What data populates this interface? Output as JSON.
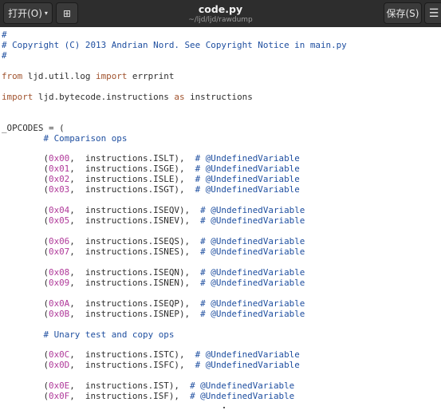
{
  "toolbar": {
    "open_label": "打开(O)",
    "open_chevron": "▾",
    "new_tab_icon_glyph": "⊞",
    "save_label": "保存(S)",
    "menu_glyph": "☰"
  },
  "window": {
    "title": "code.py",
    "subtitle": "~/ljd/ljd/rawdump"
  },
  "colors": {
    "comment": "#1f4fa0",
    "keyword": "#a0522d",
    "number": "#b03a9a",
    "text": "#2e2e2e"
  },
  "code_lines": [
    [
      {
        "t": "#",
        "c": "comment"
      }
    ],
    [
      {
        "t": "# Copyright (C) 2013 Andrian Nord. See Copyright Notice in main.py",
        "c": "comment"
      }
    ],
    [
      {
        "t": "#",
        "c": "comment"
      }
    ],
    [],
    [
      {
        "t": "from",
        "c": "keyword"
      },
      {
        "t": " ljd.util.log "
      },
      {
        "t": "import",
        "c": "keyword"
      },
      {
        "t": " errprint"
      }
    ],
    [],
    [
      {
        "t": "import",
        "c": "keyword"
      },
      {
        "t": " ljd.bytecode.instructions "
      },
      {
        "t": "as",
        "c": "keyword"
      },
      {
        "t": " instructions"
      }
    ],
    [],
    [],
    [
      {
        "t": "_OPCODES = ("
      }
    ],
    [
      {
        "t": "        "
      },
      {
        "t": "# Comparison ops",
        "c": "comment"
      }
    ],
    [],
    [
      {
        "t": "        ("
      },
      {
        "t": "0x00",
        "c": "number"
      },
      {
        "t": ",  instructions.ISLT),  "
      },
      {
        "t": "# @UndefinedVariable",
        "c": "comment"
      }
    ],
    [
      {
        "t": "        ("
      },
      {
        "t": "0x01",
        "c": "number"
      },
      {
        "t": ",  instructions.ISGE),  "
      },
      {
        "t": "# @UndefinedVariable",
        "c": "comment"
      }
    ],
    [
      {
        "t": "        ("
      },
      {
        "t": "0x02",
        "c": "number"
      },
      {
        "t": ",  instructions.ISLE),  "
      },
      {
        "t": "# @UndefinedVariable",
        "c": "comment"
      }
    ],
    [
      {
        "t": "        ("
      },
      {
        "t": "0x03",
        "c": "number"
      },
      {
        "t": ",  instructions.ISGT),  "
      },
      {
        "t": "# @UndefinedVariable",
        "c": "comment"
      }
    ],
    [],
    [
      {
        "t": "        ("
      },
      {
        "t": "0x04",
        "c": "number"
      },
      {
        "t": ",  instructions.ISEQV),  "
      },
      {
        "t": "# @UndefinedVariable",
        "c": "comment"
      }
    ],
    [
      {
        "t": "        ("
      },
      {
        "t": "0x05",
        "c": "number"
      },
      {
        "t": ",  instructions.ISNEV),  "
      },
      {
        "t": "# @UndefinedVariable",
        "c": "comment"
      }
    ],
    [],
    [
      {
        "t": "        ("
      },
      {
        "t": "0x06",
        "c": "number"
      },
      {
        "t": ",  instructions.ISEQS),  "
      },
      {
        "t": "# @UndefinedVariable",
        "c": "comment"
      }
    ],
    [
      {
        "t": "        ("
      },
      {
        "t": "0x07",
        "c": "number"
      },
      {
        "t": ",  instructions.ISNES),  "
      },
      {
        "t": "# @UndefinedVariable",
        "c": "comment"
      }
    ],
    [],
    [
      {
        "t": "        ("
      },
      {
        "t": "0x08",
        "c": "number"
      },
      {
        "t": ",  instructions.ISEQN),  "
      },
      {
        "t": "# @UndefinedVariable",
        "c": "comment"
      }
    ],
    [
      {
        "t": "        ("
      },
      {
        "t": "0x09",
        "c": "number"
      },
      {
        "t": ",  instructions.ISNEN),  "
      },
      {
        "t": "# @UndefinedVariable",
        "c": "comment"
      }
    ],
    [],
    [
      {
        "t": "        ("
      },
      {
        "t": "0x0A",
        "c": "number"
      },
      {
        "t": ",  instructions.ISEQP),  "
      },
      {
        "t": "# @UndefinedVariable",
        "c": "comment"
      }
    ],
    [
      {
        "t": "        ("
      },
      {
        "t": "0x0B",
        "c": "number"
      },
      {
        "t": ",  instructions.ISNEP),  "
      },
      {
        "t": "# @UndefinedVariable",
        "c": "comment"
      }
    ],
    [],
    [
      {
        "t": "        "
      },
      {
        "t": "# Unary test and copy ops",
        "c": "comment"
      }
    ],
    [],
    [
      {
        "t": "        ("
      },
      {
        "t": "0x0C",
        "c": "number"
      },
      {
        "t": ",  instructions.ISTC),  "
      },
      {
        "t": "# @UndefinedVariable",
        "c": "comment"
      }
    ],
    [
      {
        "t": "        ("
      },
      {
        "t": "0x0D",
        "c": "number"
      },
      {
        "t": ",  instructions.ISFC),  "
      },
      {
        "t": "# @UndefinedVariable",
        "c": "comment"
      }
    ],
    [],
    [
      {
        "t": "        ("
      },
      {
        "t": "0x0E",
        "c": "number"
      },
      {
        "t": ",  instructions.IST),  "
      },
      {
        "t": "# @UndefinedVariable",
        "c": "comment"
      }
    ],
    [
      {
        "t": "        ("
      },
      {
        "t": "0x0F",
        "c": "number"
      },
      {
        "t": ",  instructions.ISF),  "
      },
      {
        "t": "# @UndefinedVariable",
        "c": "comment"
      }
    ]
  ]
}
